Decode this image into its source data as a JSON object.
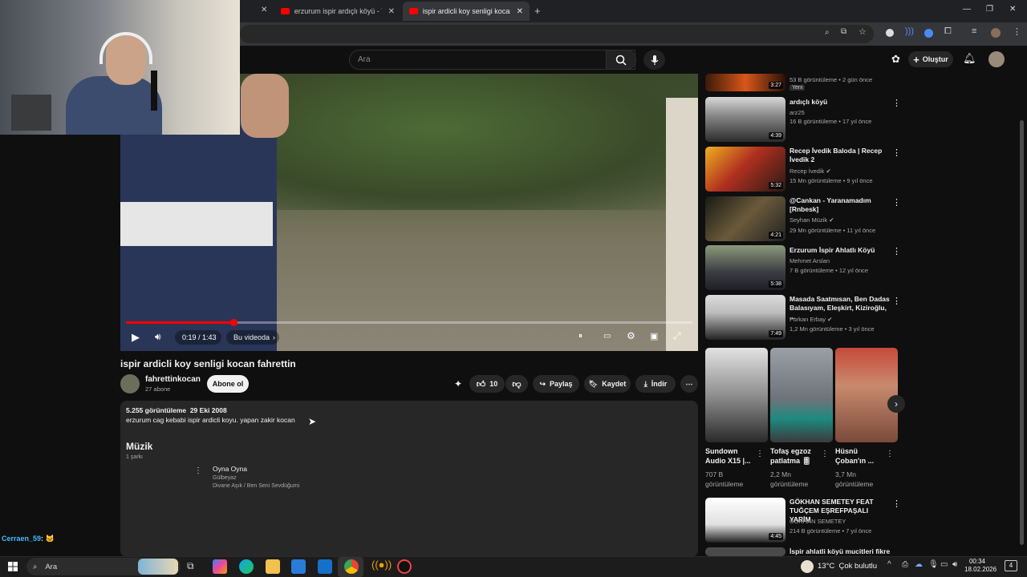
{
  "browser": {
    "tabs": [
      {
        "label": "erzurum ispir ardıçlı köyü - You"
      },
      {
        "label": "ispir ardicli koy senligi kocan fa"
      }
    ]
  },
  "header": {
    "search_placeholder": "Ara",
    "create_label": "Oluştur"
  },
  "player": {
    "time": "0:19 / 1:43",
    "in_video_label": "Bu videoda",
    "progress_fraction": 0.19
  },
  "video": {
    "title": "ispir ardicli koy senligi kocan fahrettin",
    "channel": "fahrettinkocan",
    "subscribers": "27 abone",
    "subscribe_label": "Abone ol",
    "likes": "10",
    "share_label": "Paylaş",
    "save_label": "Kaydet",
    "download_label": "İndir"
  },
  "description": {
    "stats": "5.255 görüntüleme  29 Eki 2008",
    "text": "erzurum cag kebabi ispir ardicli koyu. yapan zakir kocan",
    "music_heading": "Müzik",
    "music_count": "1 şarkı",
    "song": {
      "title": "Oyna Oyna",
      "artist": "Gülbeyaz",
      "album": "Divane Aşık / Ben Seni Sevdüğumi"
    }
  },
  "sidebar": {
    "top_partial": {
      "duration": "3:27",
      "meta": "53 B görüntüleme • 2 gün önce",
      "badge": "Yeni"
    },
    "items": [
      {
        "title": "ardıçlı köyü",
        "channel": "arz25",
        "meta": "16 B görüntüleme • 17 yıl önce",
        "duration": "4:39"
      },
      {
        "title": "Recep İvedik Baloda | Recep İvedik 2",
        "channel": "Recep İvedik",
        "meta": "15 Mn görüntüleme • 9 yıl önce",
        "duration": "5:32"
      },
      {
        "title": "@Cankan - Yaranamadım [Rnbesk]",
        "channel": "Seyhan Müzik",
        "meta": "29 Mn görüntüleme • 11 yıl önce",
        "duration": "4:21"
      },
      {
        "title": "Erzurum İspir Ahlatlı Köyü",
        "channel": "Mehmet Arslan",
        "meta": "7 B görüntüleme • 12 yıl önce",
        "duration": "5:38"
      },
      {
        "title": "Masada Saatmısan, Ben Dadas Balasıyam, Eleşkirt, Kiziroğlu, ...",
        "channel": "Furkan Erbay",
        "meta": "1,2 Mn görüntüleme • 3 yıl önce",
        "duration": "7:49"
      }
    ],
    "shorts": [
      {
        "title": "Sundown Audio X15 |...",
        "meta1": "707 B",
        "meta2": "görüntüleme"
      },
      {
        "title": "Tofaş egzoz patlatma 🎚",
        "meta1": "2,2 Mn",
        "meta2": "görüntüleme"
      },
      {
        "title": "Hüsnü Çoban'ın ...",
        "meta1": "3,7 Mn",
        "meta2": "görüntüleme"
      }
    ],
    "bottom_items": [
      {
        "title": "GÖKHAN SEMETEY FEAT TUĞÇEM EŞREFPAŞALI YARİM",
        "channel": "GÖKHAN SEMETEY",
        "meta": "214 B görüntüleme • 7 yıl önce",
        "duration": "4:45"
      },
      {
        "title": "İspir ahlatli köyü mucitleri fikret"
      }
    ]
  },
  "chat": {
    "user": "Cerraen_59",
    "message": ": 🐱"
  },
  "taskbar": {
    "search_label": "Ara",
    "weather": "13°C  Çok bulutlu",
    "time": "00:34",
    "date": "18.02.2026",
    "notif_count": "4"
  }
}
